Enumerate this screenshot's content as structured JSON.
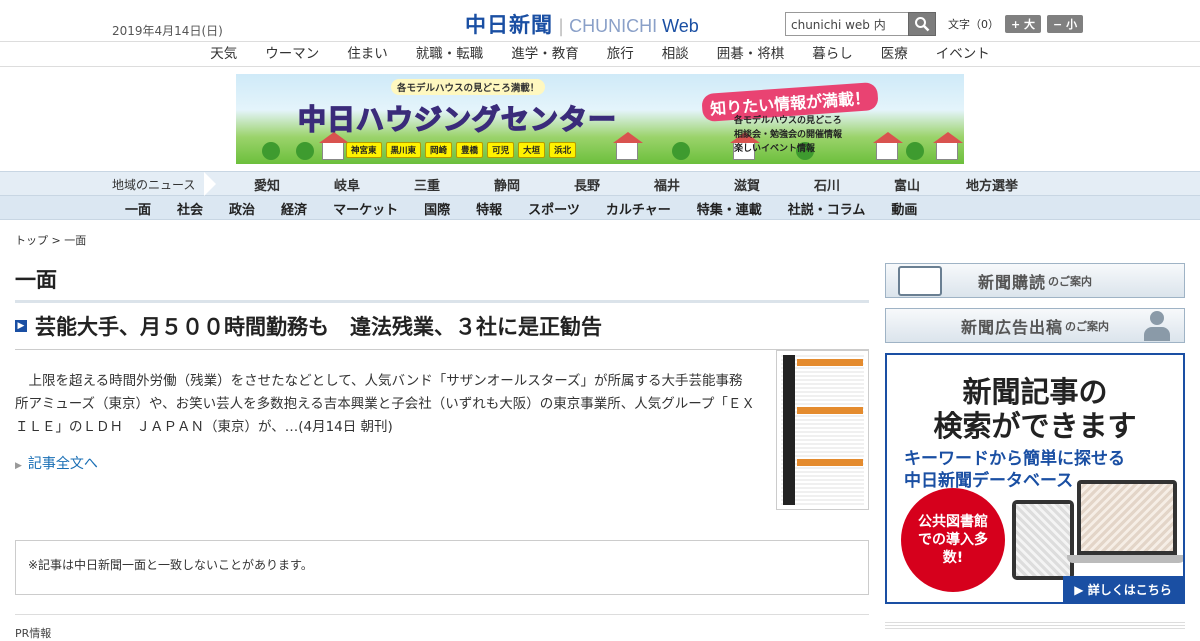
{
  "header": {
    "date": "2019年4月14日(日)",
    "logo_ja": "中日新聞",
    "logo_en_a": "CHUNICHI",
    "logo_en_b": "Web",
    "search_placeholder": "chunichi web 内",
    "font_label": "文字（0）",
    "font_bigger": "+ 大",
    "font_smaller": "− 小"
  },
  "category_nav": [
    "天気",
    "ウーマン",
    "住まい",
    "就職・転職",
    "進学・教育",
    "旅行",
    "相談",
    "囲碁・将棋",
    "暮らし",
    "医療",
    "イベント"
  ],
  "banner": {
    "top_text": "各モデルハウスの見どころ満載！",
    "title": "中日ハウジングセンター",
    "catch": "知りたい情報が満載！",
    "list": [
      "各モデルハウスの見どころ",
      "相談会・勉強会の開催情報",
      "楽しいイベント情報"
    ],
    "areas": [
      "神宮東",
      "黒川東",
      "岡崎",
      "豊橋",
      "可児",
      "大垣",
      "浜北"
    ]
  },
  "region_nav": {
    "label": "地域のニュース",
    "items": [
      "愛知",
      "岐阜",
      "三重",
      "静岡",
      "長野",
      "福井",
      "滋賀",
      "石川",
      "富山",
      "地方選挙"
    ]
  },
  "section_nav": [
    "一面",
    "社会",
    "政治",
    "経済",
    "マーケット",
    "国際",
    "特報",
    "スポーツ",
    "カルチャー",
    "特集・連載",
    "社説・コラム",
    "動画"
  ],
  "breadcrumb": {
    "top": "トップ",
    "sep": " > ",
    "current": "一面"
  },
  "page_title": "一面",
  "article": {
    "headline": "芸能大手、月５００時間勤務も　違法残業、３社に是正勧告",
    "body": "上限を超える時間外労働（残業）をさせたなどとして、人気バンド「サザンオールスターズ」が所属する大手芸能事務所アミューズ（東京）や、お笑い芸人を多数抱える吉本興業と子会社（いずれも大阪）の東京事業所、人気グループ「ＥＸＩＬＥ」のＬＤＨ　ＪＡＰＡＮ（東京）が、…",
    "date": "(4月14日 朝刊)",
    "read_more": "記事全文へ"
  },
  "notice": "※記事は中日新聞一面と一致しないことがあります。",
  "pr": "PR情報",
  "sidebar": {
    "subscribe_main": "新聞購読",
    "subscribe_sub": "のご案内",
    "advert_main": "新聞広告出稿",
    "advert_sub": "のご案内",
    "ad_line1": "新聞記事の",
    "ad_line2": "検索ができます",
    "ad_line3": "キーワードから簡単に探せる",
    "ad_line4": "中日新聞データベース",
    "ad_circle": "公共図書館での導入多数!",
    "ad_more": "▶ 詳しくはこちら"
  },
  "colors": {
    "brand": "#1a4fa3",
    "nav_bg": "#e4edf5",
    "ad_red": "#d6001c"
  }
}
